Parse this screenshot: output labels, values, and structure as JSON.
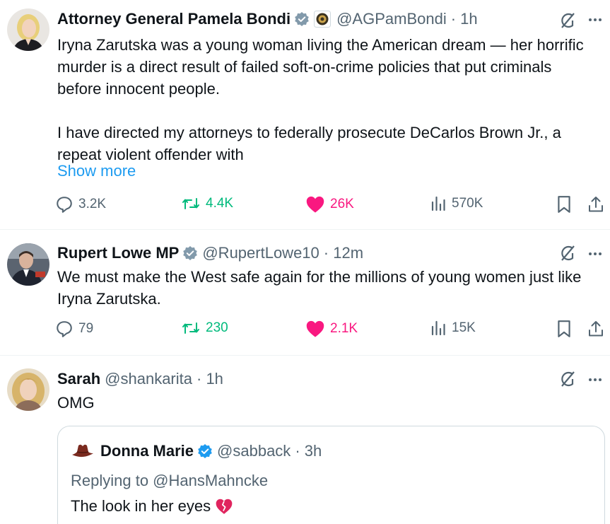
{
  "colors": {
    "text": "#0f1419",
    "secondary": "#536471",
    "link": "#1d9bf0",
    "retweet": "#00ba7c",
    "like": "#f91880",
    "verified": "#829aab",
    "verified_blue": "#1d9bf0"
  },
  "tweets": [
    {
      "name": "Attorney General Pamela Bondi",
      "handle": "@AGPamBondi",
      "time": "· 1h",
      "text": "Iryna Zarutska was a young woman living the American dream — her horrific murder is a direct result of failed soft-on-crime policies that put criminals before innocent people.\n\nI have directed my attorneys to federally prosecute DeCarlos Brown Jr., a repeat violent offender with",
      "show_more": "Show more",
      "replies": "3.2K",
      "reposts": "4.4K",
      "likes": "26K",
      "views": "570K"
    },
    {
      "name": "Rupert Lowe MP",
      "handle": "@RupertLowe10",
      "time": "· 12m",
      "text": "We must make the West safe again for the millions of young women just like Iryna Zarutska.",
      "replies": "79",
      "reposts": "230",
      "likes": "2.1K",
      "views": "15K"
    },
    {
      "name": "Sarah",
      "handle": "@shankarita",
      "time": "· 1h",
      "text": "OMG",
      "quote": {
        "name": "Donna Marie",
        "handle": "@sabback",
        "time": "· 3h",
        "replying": "Replying to @HansMahncke",
        "text": "The look in her eyes",
        "emoji": "broken-heart-icon"
      }
    }
  ]
}
